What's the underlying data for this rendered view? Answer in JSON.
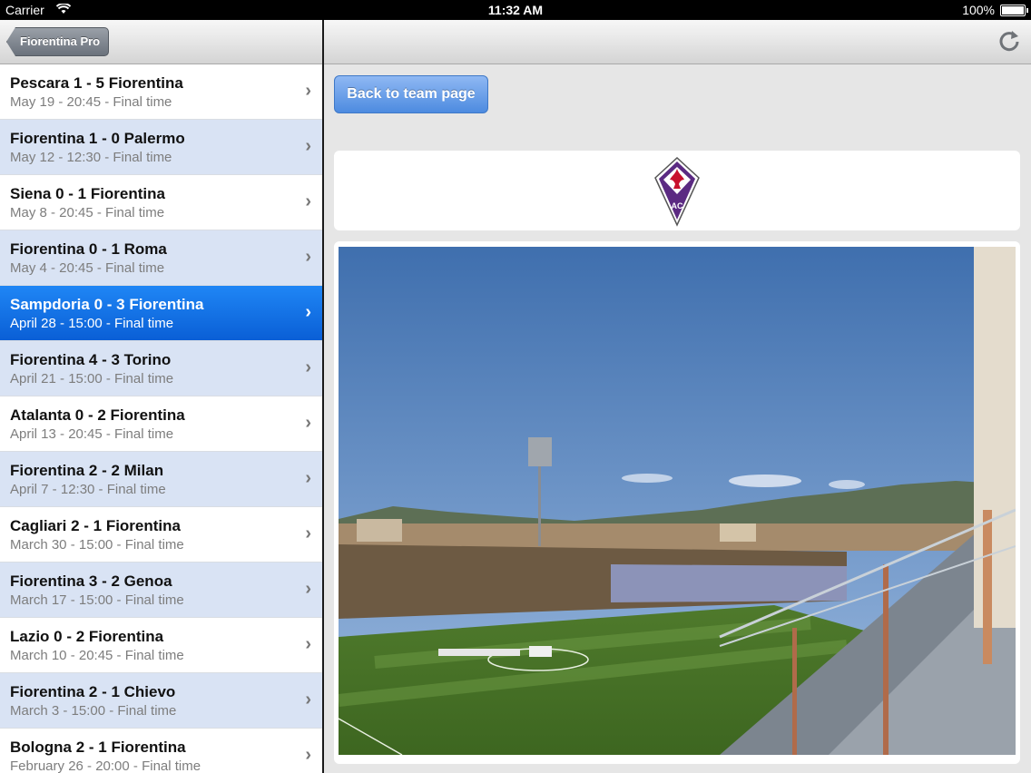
{
  "status_bar": {
    "carrier": "Carrier",
    "time": "11:32 AM",
    "battery": "100%"
  },
  "left_nav": {
    "back_label": "Fiorentina Pro"
  },
  "matches": [
    {
      "title": "Pescara 1 - 5 Fiorentina",
      "subtitle": "May 19 - 20:45 - Final time"
    },
    {
      "title": "Fiorentina 1 - 0 Palermo",
      "subtitle": "May 12 - 12:30 - Final time"
    },
    {
      "title": "Siena 0 - 1 Fiorentina",
      "subtitle": "May 8 - 20:45 - Final time"
    },
    {
      "title": "Fiorentina 0 - 1 Roma",
      "subtitle": "May 4 - 20:45 - Final time"
    },
    {
      "title": "Sampdoria 0 - 3 Fiorentina",
      "subtitle": "April 28 - 15:00 - Final time"
    },
    {
      "title": "Fiorentina 4 - 3 Torino",
      "subtitle": "April 21 - 15:00 - Final time"
    },
    {
      "title": "Atalanta 0 - 2 Fiorentina",
      "subtitle": "April 13 - 20:45 - Final time"
    },
    {
      "title": "Fiorentina 2 - 2 Milan",
      "subtitle": "April 7 - 12:30 - Final time"
    },
    {
      "title": "Cagliari 2 - 1 Fiorentina",
      "subtitle": "March 30 - 15:00 - Final time"
    },
    {
      "title": "Fiorentina 3 - 2 Genoa",
      "subtitle": "March 17 - 15:00 - Final time"
    },
    {
      "title": "Lazio 0 - 2 Fiorentina",
      "subtitle": "March 10 - 20:45 - Final time"
    },
    {
      "title": "Fiorentina 2 - 1 Chievo",
      "subtitle": "March 3 - 15:00 - Final time"
    },
    {
      "title": "Bologna 2 - 1 Fiorentina",
      "subtitle": "February 26 - 20:00 - Final time"
    }
  ],
  "selected_index": 4,
  "detail": {
    "back_to_team_label": "Back to team page",
    "refresh_icon": "refresh-icon",
    "crest_icon": "fiorentina-crest-icon",
    "crest_letters": "AC"
  },
  "colors": {
    "selected_row": "#1a73e8",
    "alt_row": "#d9e3f4",
    "button_blue": "#4d8be0",
    "crest_purple": "#5b2a82",
    "crest_red": "#c8102e"
  }
}
